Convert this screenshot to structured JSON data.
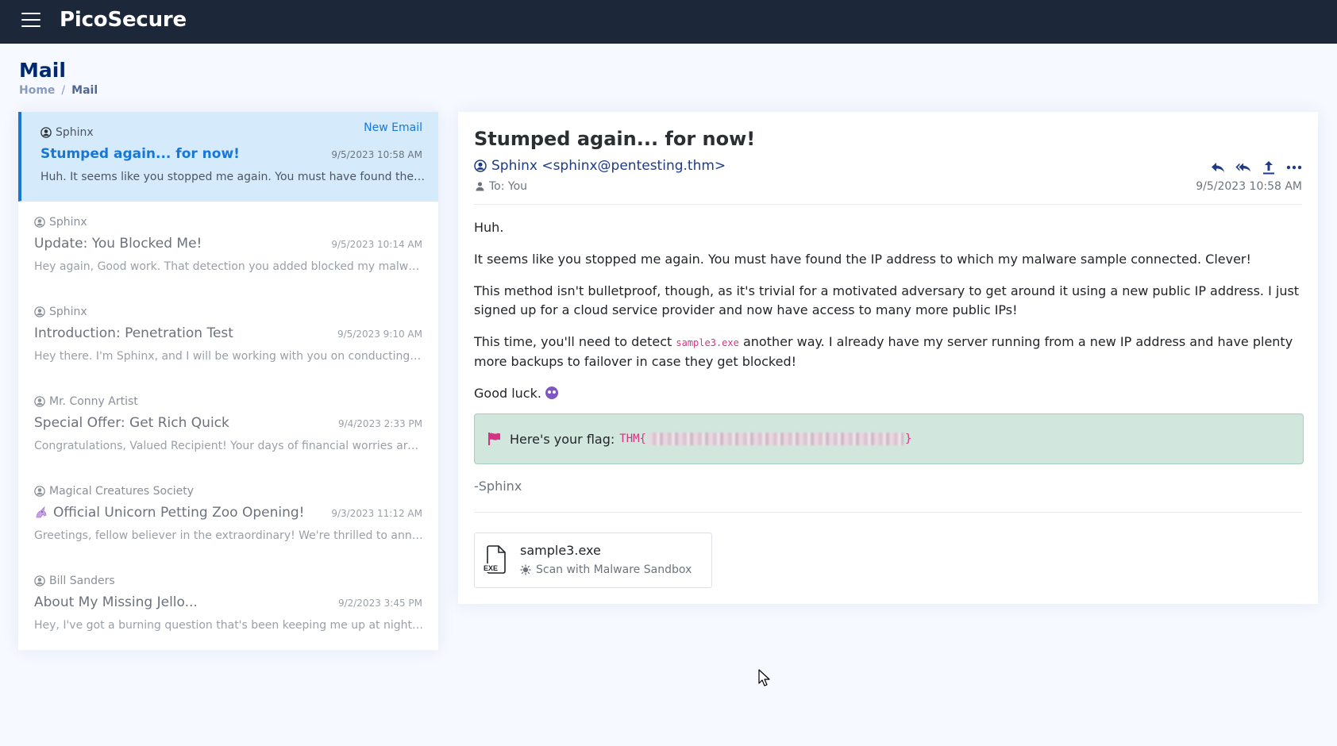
{
  "app": {
    "brand": "PicoSecure"
  },
  "page": {
    "title": "Mail",
    "breadcrumb": {
      "home": "Home",
      "separator": "/",
      "current": "Mail"
    }
  },
  "mail_list": {
    "items": [
      {
        "sender": "Sphinx",
        "subject": "Stumped again... for now!",
        "date": "9/5/2023 10:58 AM",
        "preview": "Huh. It seems like you stopped me again. You must have found the IP address to which my malware sample connected. Clever!",
        "badge": "New Email",
        "active": true
      },
      {
        "sender": "Sphinx",
        "subject": "Update: You Blocked Me!",
        "date": "9/5/2023 10:14 AM",
        "preview": "Hey again, Good work. That detection you added blocked my malware from connecting to my server."
      },
      {
        "sender": "Sphinx",
        "subject": "Introduction: Penetration Test",
        "date": "9/5/2023 9:10 AM",
        "preview": "Hey there. I'm Sphinx, and I will be working with you on conducting threat simulations."
      },
      {
        "sender": "Mr. Conny Artist",
        "subject": "Special Offer: Get Rich Quick",
        "date": "9/4/2023 2:33 PM",
        "preview": "Congratulations, Valued Recipient! Your days of financial worries are over forever."
      },
      {
        "sender": "Magical Creatures Society",
        "subject": "Official Unicorn Petting Zoo Opening!",
        "date": "9/3/2023 11:12 AM",
        "preview": "Greetings, fellow believer in the extraordinary! We're thrilled to announce the grand opening."
      },
      {
        "sender": "Bill Sanders",
        "subject": "About My Missing Jello...",
        "date": "9/2/2023 3:45 PM",
        "preview": "Hey, I've got a burning question that's been keeping me up at night... well, sort of."
      }
    ]
  },
  "reader": {
    "subject": "Stumped again... for now!",
    "from": "Sphinx <sphinx@pentesting.thm>",
    "to": "To: You",
    "date": "9/5/2023 10:58 AM",
    "body": {
      "p1": "Huh.",
      "p2": "It seems like you stopped me again. You must have found the IP address to which my malware sample connected. Clever!",
      "p3": "This method isn't bulletproof, though, as it's trivial for a motivated adversary to get around it using a new public IP address. I just signed up for a cloud service provider and now have access to many more public IPs!",
      "p4_before": "This time, you'll need to detect ",
      "p4_code": "sample3.exe",
      "p4_after": " another way. I already have my server running from a new IP address and have plenty more backups to failover in case they get blocked!",
      "p5": "Good luck."
    },
    "flag": {
      "label": "Here's your flag:",
      "prefix": "THM{",
      "suffix": "}"
    },
    "signoff": "-Sphinx",
    "attachment": {
      "name": "sample3.exe",
      "type_label": "EXE",
      "action": "Scan with Malware Sandbox"
    }
  },
  "colors": {
    "topbar": "#1c2739",
    "accent": "#1877d6",
    "active_bg": "#d5ebfb",
    "flag_bg": "#d1e7dd",
    "code": "#d63384"
  }
}
